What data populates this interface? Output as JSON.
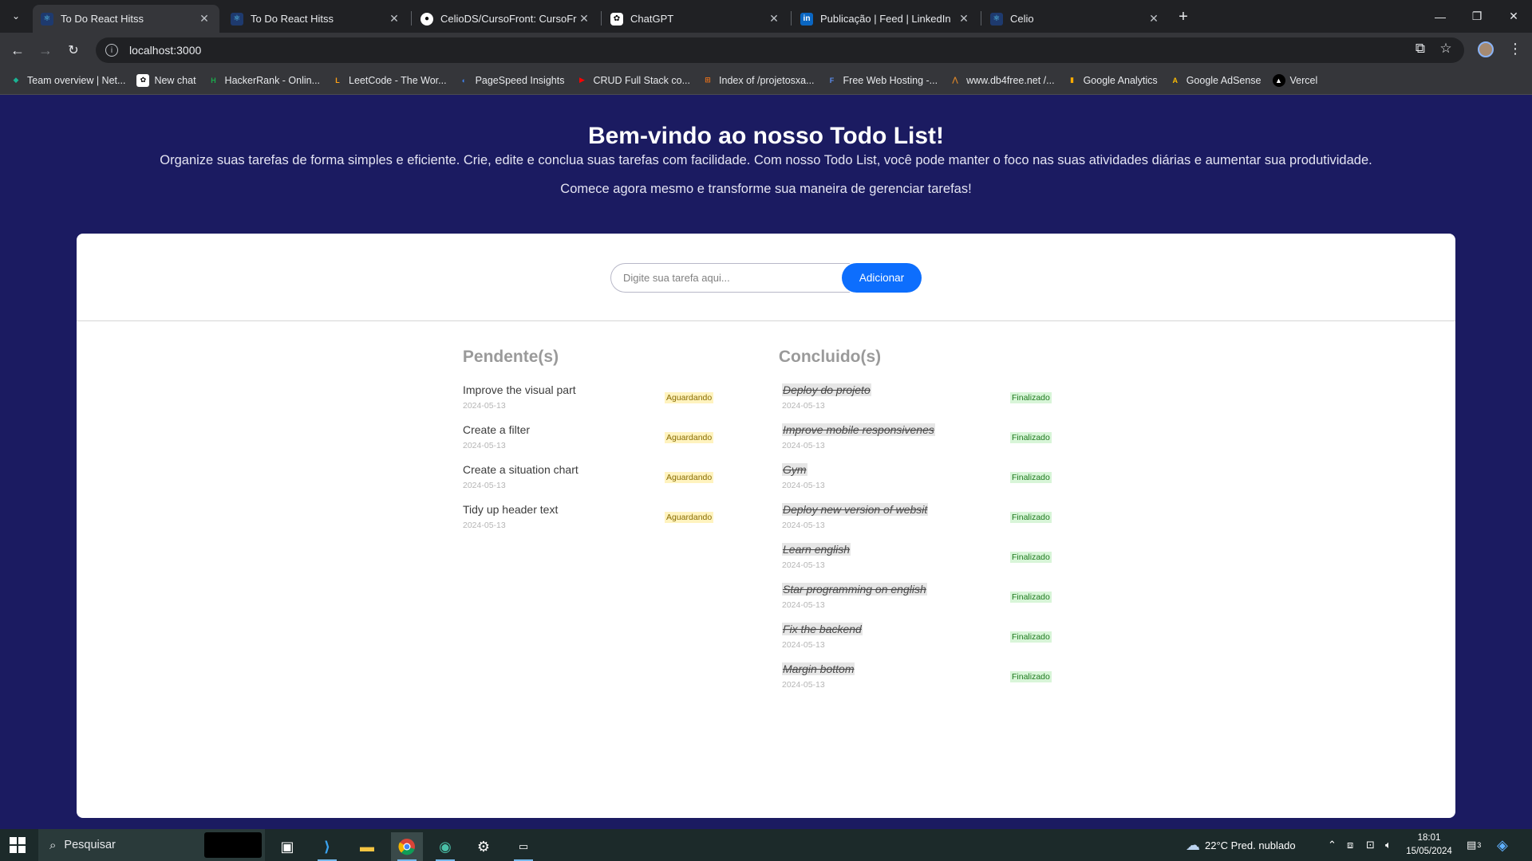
{
  "browser": {
    "tabs": [
      {
        "title": "To Do React Hitss",
        "icon": "react-icon",
        "active": true
      },
      {
        "title": "To Do React Hitss",
        "icon": "react-icon",
        "active": false
      },
      {
        "title": "CelioDS/CursoFront: CursoFront",
        "icon": "github-icon",
        "active": false
      },
      {
        "title": "ChatGPT",
        "icon": "chatgpt-icon",
        "active": false
      },
      {
        "title": "Publicação | Feed | LinkedIn",
        "icon": "linkedin-icon",
        "active": false
      },
      {
        "title": "Celio",
        "icon": "react-icon",
        "active": false
      }
    ],
    "url": "localhost:3000",
    "bookmarks": [
      "Team overview | Net...",
      "New chat",
      "HackerRank - Onlin...",
      "LeetCode - The Wor...",
      "PageSpeed Insights",
      "CRUD Full Stack co...",
      "Index of /projetosxa...",
      "Free Web Hosting -...",
      "www.db4free.net /...",
      "Google Analytics",
      "Google AdSense",
      "Vercel"
    ]
  },
  "page": {
    "title": "Bem-vindo ao nosso Todo List!",
    "subtitle": "Organize suas tarefas de forma simples e eficiente. Crie, edite e conclua suas tarefas com facilidade. Com nosso Todo List, você pode manter o foco nas suas atividades diárias e aumentar sua produtividade.",
    "subtitle2": "Comece agora mesmo e transforme sua maneira de gerenciar tarefas!",
    "input_placeholder": "Digite sua tarefa aqui...",
    "add_label": "Adicionar",
    "pending_title": "Pendente(s)",
    "done_title": "Concluido(s)",
    "pending": [
      {
        "name": "Improve the visual part",
        "date": "2024-05-13",
        "status": "Aguardando"
      },
      {
        "name": "Create a filter",
        "date": "2024-05-13",
        "status": "Aguardando"
      },
      {
        "name": "Create a situation chart",
        "date": "2024-05-13",
        "status": "Aguardando"
      },
      {
        "name": "Tidy up header text",
        "date": "2024-05-13",
        "status": "Aguardando"
      }
    ],
    "done": [
      {
        "name": "Deploy do projeto",
        "date": "2024-05-13",
        "status": "Finalizado"
      },
      {
        "name": "Improve mobile responsivenes",
        "date": "2024-05-13",
        "status": "Finalizado"
      },
      {
        "name": "Gym",
        "date": "2024-05-13",
        "status": "Finalizado"
      },
      {
        "name": "Deploy new version of websit",
        "date": "2024-05-13",
        "status": "Finalizado"
      },
      {
        "name": "Learn english",
        "date": "2024-05-13",
        "status": "Finalizado"
      },
      {
        "name": "Star programming on english",
        "date": "2024-05-13",
        "status": "Finalizado"
      },
      {
        "name": "Fix the backend",
        "date": "2024-05-13",
        "status": "Finalizado"
      },
      {
        "name": "Margin bottom",
        "date": "2024-05-13",
        "status": "Finalizado"
      }
    ]
  },
  "taskbar": {
    "search_placeholder": "Pesquisar",
    "weather": "22°C  Pred. nublado",
    "time": "18:01",
    "date": "15/05/2024",
    "notification_count": "3"
  },
  "colors": {
    "page_bg": "#1b1b61",
    "accent": "#0d6efd",
    "pending_badge": "#fff3bf",
    "done_badge": "#d8f5d8"
  }
}
